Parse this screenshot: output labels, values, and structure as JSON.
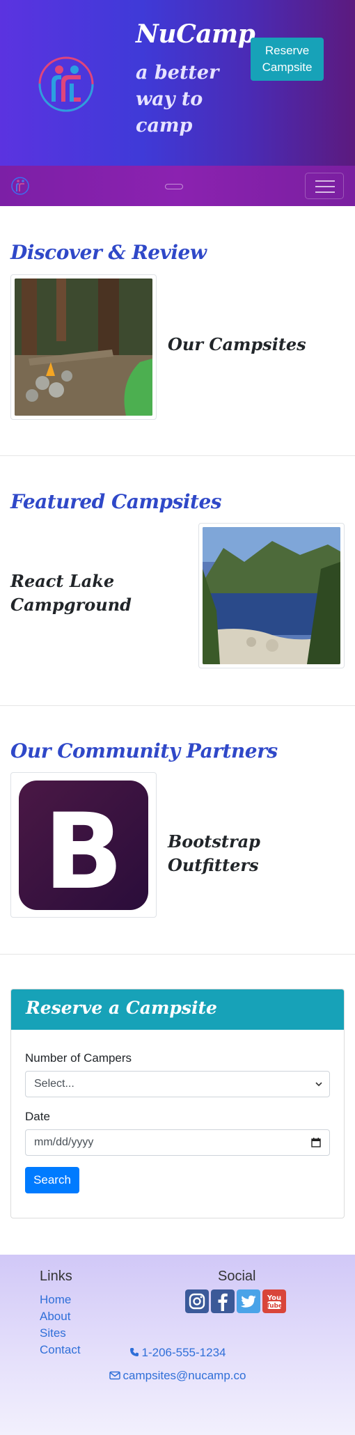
{
  "header": {
    "brand": "NuCamp",
    "tagline": "a better way to camp",
    "reserve_button": "Reserve Campsite"
  },
  "navbar": {
    "toggler_label": "menu"
  },
  "discover": {
    "heading": "Discover & Review",
    "card_title": "Our Campsites"
  },
  "featured": {
    "heading": "Featured Campsites",
    "card_title": "React Lake Campground"
  },
  "partners": {
    "heading": "Our Community Partners",
    "card_title": "Bootstrap Outfitters",
    "logo_letter": "B"
  },
  "reserve": {
    "title": "Reserve a Campsite",
    "campers_label": "Number of Campers",
    "campers_selected": "Select...",
    "date_label": "Date",
    "date_placeholder": "mm/dd/yyyy",
    "search_button": "Search"
  },
  "footer": {
    "links_heading": "Links",
    "links": [
      "Home",
      "About",
      "Sites",
      "Contact"
    ],
    "social_heading": "Social",
    "social_icons": [
      "instagram-icon",
      "facebook-icon",
      "twitter-icon",
      "youtube-icon"
    ],
    "phone": "1-206-555-1234",
    "email": "campsites@nucamp.co"
  },
  "colors": {
    "brand_heading": "#2f48c8",
    "teal": "#17a2b8",
    "nav": "#8e24aa",
    "primary": "#007bff"
  }
}
